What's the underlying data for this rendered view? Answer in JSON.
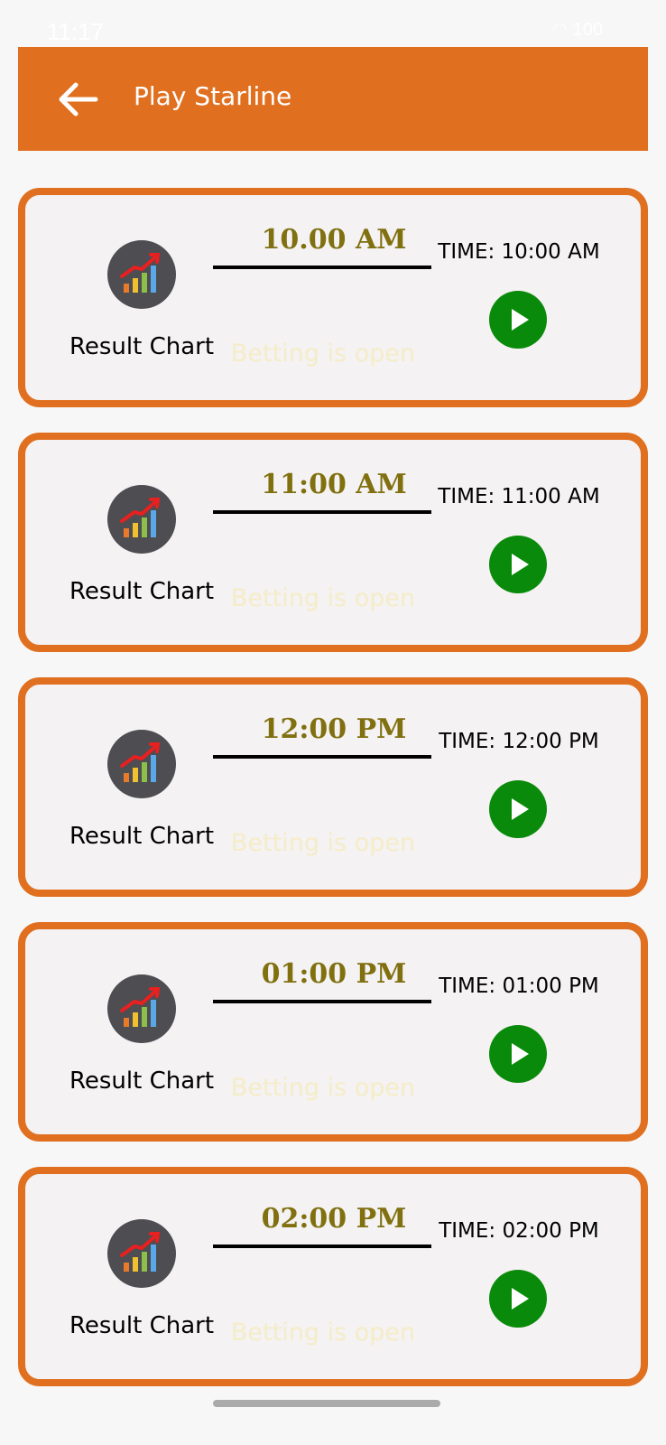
{
  "status_bar": {
    "time": "11:17",
    "battery": "100"
  },
  "header": {
    "title": "Play Starline"
  },
  "colors": {
    "accent": "#e07020",
    "play_green": "#0a8a0a",
    "slot_time_color": "#807010"
  },
  "slots": [
    {
      "slot_time": "10.00 AM",
      "time_label": "TIME: 10:00 AM",
      "chart_label": "Result Chart",
      "status": "Betting is open"
    },
    {
      "slot_time": "11:00 AM",
      "time_label": "TIME: 11:00 AM",
      "chart_label": "Result Chart",
      "status": "Betting is open"
    },
    {
      "slot_time": "12:00 PM",
      "time_label": "TIME: 12:00 PM",
      "chart_label": "Result Chart",
      "status": "Betting is open"
    },
    {
      "slot_time": "01:00 PM",
      "time_label": "TIME: 01:00 PM",
      "chart_label": "Result Chart",
      "status": "Betting is open"
    },
    {
      "slot_time": "02:00 PM",
      "time_label": "TIME: 02:00 PM",
      "chart_label": "Result Chart",
      "status": "Betting is open"
    }
  ]
}
